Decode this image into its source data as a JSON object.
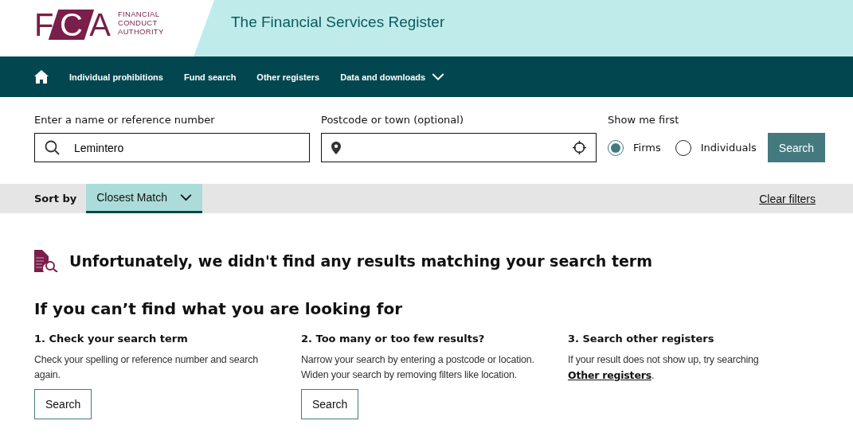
{
  "logo": {
    "letters": [
      {
        "text": "F",
        "kind": "plain"
      },
      {
        "text": "C",
        "kind": "boxed"
      },
      {
        "text": "A",
        "kind": "plain"
      }
    ],
    "name_lines": [
      "FINANCIAL",
      "CONDUCT",
      "AUTHORITY"
    ]
  },
  "header": {
    "title": "The Financial Services Register"
  },
  "nav": {
    "items": [
      {
        "label": "Individual prohibitions",
        "has_dropdown": false
      },
      {
        "label": "Fund search",
        "has_dropdown": false
      },
      {
        "label": "Other registers",
        "has_dropdown": false
      },
      {
        "label": "Data and downloads",
        "has_dropdown": true
      }
    ]
  },
  "search": {
    "name_field": {
      "label": "Enter a name or reference number",
      "value": "Lemintero"
    },
    "location_field": {
      "label": "Postcode or town (optional)"
    },
    "show_me_first": {
      "label": "Show me first",
      "options": [
        {
          "label": "Firms",
          "selected": true
        },
        {
          "label": "Individuals",
          "selected": false
        }
      ]
    },
    "button": "Search"
  },
  "sort_bar": {
    "label": "Sort by",
    "value": "Closest Match",
    "clear": "Clear filters"
  },
  "no_results": {
    "message": "Unfortunately, we didn't find any results matching your search term"
  },
  "help": {
    "title": "If you can’t find what you are looking for",
    "columns": [
      {
        "heading": "1. Check your search term",
        "text": "Check your spelling or reference number and search again.",
        "button": "Search"
      },
      {
        "heading": "2. Too many or too few results?",
        "text": "Narrow your search by entering a postcode or location. Widen your search by removing filters like location.",
        "button": "Search"
      },
      {
        "heading": "3. Search other registers",
        "text": "If your result does not show up, try searching",
        "link": "Other registers",
        "after": "."
      }
    ]
  }
}
